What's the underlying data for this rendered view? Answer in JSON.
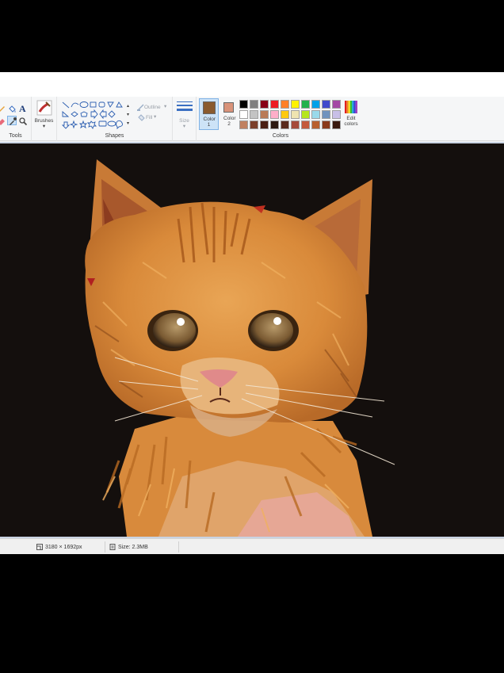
{
  "ribbon": {
    "tools_label": "Tools",
    "brushes_label": "Brushes",
    "shapes_label": "Shapes",
    "outline_label": "Outline",
    "fill_label": "Fill",
    "size_label": "Size",
    "color1_label": "Color 1",
    "color2_label": "Color 2",
    "colors_label": "Colors",
    "edit_colors_label": "Edit colors"
  },
  "colors": {
    "color1": "#8a5a2e",
    "color2": "#d9937a",
    "palette_row1": [
      "#000000",
      "#7f7f7f",
      "#880015",
      "#ed1c24",
      "#ff7f27",
      "#fff200",
      "#22b14c",
      "#00a2e8",
      "#3f48cc",
      "#a349a4"
    ],
    "palette_row2": [
      "#ffffff",
      "#c3c3c3",
      "#b97a57",
      "#ffaec9",
      "#ffc90e",
      "#efe4b0",
      "#b5e61d",
      "#99d9ea",
      "#7092be",
      "#c8bfe7"
    ],
    "palette_row3": [
      "#c08060",
      "#7a3f2a",
      "#4a1e12",
      "#2e1a12",
      "#5a2a1c",
      "#a64b3a",
      "#c45a3c",
      "#b8602e",
      "#8a3a1c",
      "#3a1a10"
    ],
    "canvas_background": "#140f0d"
  },
  "status": {
    "dimensions": "3180 × 1692px",
    "size": "Size: 2.3MB"
  }
}
